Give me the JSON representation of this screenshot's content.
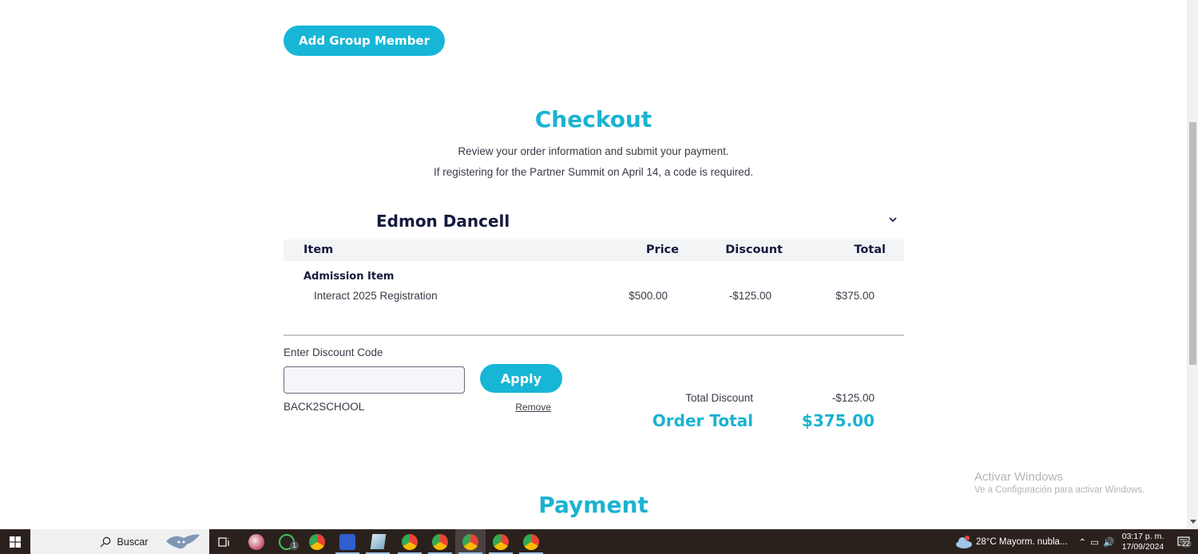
{
  "page": {
    "add_group_member_label": "Add Group Member",
    "checkout": {
      "title": "Checkout",
      "subtitle_1": "Review your order information and submit your payment.",
      "subtitle_2": "If registering for the Partner Summit on April 14, a code is required."
    },
    "attendee": {
      "name": "Edmon Dancell",
      "collapse_icon": "chevron-down-icon"
    },
    "table": {
      "headers": {
        "item": "Item",
        "price": "Price",
        "discount": "Discount",
        "total": "Total"
      },
      "groups": [
        {
          "label": "Admission Item",
          "rows": [
            {
              "name": "Interact 2025 Registration",
              "price": "$500.00",
              "discount": "-$125.00",
              "total": "$375.00"
            }
          ]
        }
      ]
    },
    "discount": {
      "label": "Enter Discount Code",
      "input_value": "",
      "input_placeholder": "",
      "apply_label": "Apply",
      "applied_code": "BACK2SCHOOL",
      "remove_label": "Remove"
    },
    "summary": {
      "total_discount_label": "Total Discount",
      "total_discount_value": "-$125.00",
      "order_total_label": "Order Total",
      "order_total_value": "$375.00"
    },
    "payment": {
      "title": "Payment"
    },
    "colors": {
      "accent": "#17b6d6",
      "heading_dark": "#141a3c",
      "table_header_bg": "#f3f4f6"
    }
  },
  "os": {
    "watermark": {
      "title": "Activar Windows",
      "subtitle": "Ve a Configuración para activar Windows."
    },
    "taskbar": {
      "search_placeholder": "Buscar",
      "apps": [
        {
          "name": "task-view-icon"
        },
        {
          "name": "app-icon"
        },
        {
          "name": "whatsapp-icon",
          "badge": "1"
        },
        {
          "name": "chrome-icon"
        },
        {
          "name": "app-blue-icon"
        },
        {
          "name": "notepad-icon"
        },
        {
          "name": "chrome-profile-icon"
        },
        {
          "name": "chrome-profile-icon"
        },
        {
          "name": "chrome-profile-icon",
          "active": true
        },
        {
          "name": "chrome-profile-icon"
        },
        {
          "name": "chrome-profile-icon"
        }
      ],
      "weather": "28°C  Mayorm. nubla...",
      "time": "03:17 p. m.",
      "date": "17/09/2024",
      "notifications_count": "22"
    }
  }
}
